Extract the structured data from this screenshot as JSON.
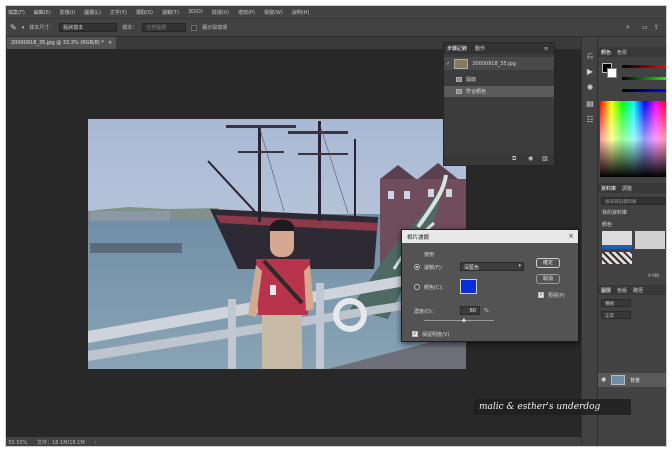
{
  "menu": [
    "檔案(F)",
    "編輯(E)",
    "影像(I)",
    "圖層(L)",
    "文字(Y)",
    "選取(S)",
    "濾鏡(T)",
    "3D(D)",
    "檢視(V)",
    "增效(P)",
    "視窗(W)",
    "說明(H)"
  ],
  "options": {
    "tool_icon": "eyedropper-icon",
    "sample_size_label": "樣本尺寸：",
    "sample_size_value": "點狀樣本",
    "sample_label": "樣本：",
    "sample_value": "全部圖層",
    "show_ring_label": "顯示取樣環"
  },
  "document_tab": {
    "label": "20000918_35.jpg @ 33.3% (RGB/8) *",
    "close": "×"
  },
  "status": {
    "zoom": "33.33%",
    "doc_size": "文件：18.1M/18.1M"
  },
  "history_panel": {
    "tabs": [
      "步驟記錄",
      "動作"
    ],
    "snapshot_name": "20000918_35.jpg",
    "steps": [
      "開啟",
      "符合顏色"
    ]
  },
  "photo_filter_dialog": {
    "title": "相片濾鏡",
    "use_label": "使用",
    "filter_label": "濾鏡(F)：",
    "filter_value": "深藍色",
    "color_label": "顏色(C)：",
    "color_swatch": "#0b2fd6",
    "density_label": "濃度(D)：",
    "density_value": "60",
    "density_unit": "%",
    "preserve_label": "保留明度(V)",
    "ok_label": "確定",
    "cancel_label": "取消",
    "preview_label": "預視(P)"
  },
  "right_panels": {
    "color_tabs": [
      "顏色",
      "色票"
    ],
    "library_tabs": [
      "資料庫",
      "調整"
    ],
    "library_search_placeholder": "搜尋目前資料庫",
    "library_name": "我的資料庫",
    "library_group": "顏色",
    "library_size": "9 MB",
    "layers_tabs": [
      "圖層",
      "色版",
      "路徑"
    ],
    "layer_kind": "種類",
    "layer_blend": "正常",
    "layer_name": "背景"
  },
  "watermark": "malic & esther's underdog"
}
